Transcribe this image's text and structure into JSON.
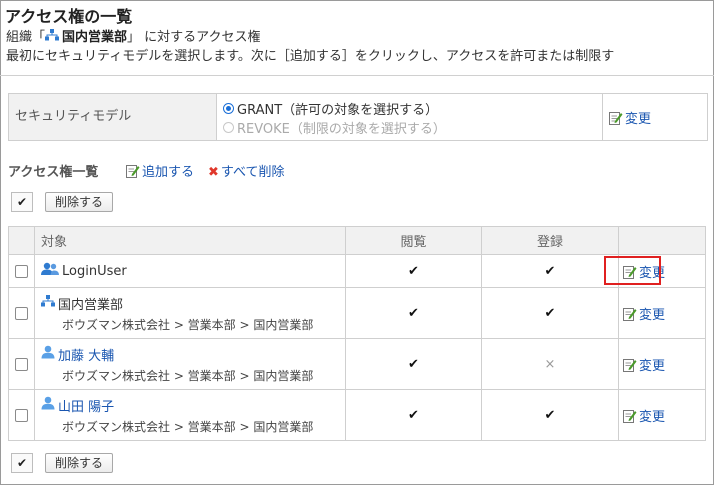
{
  "page": {
    "title": "アクセス権の一覧",
    "intro_prefix": "組織「",
    "org_name": "国内営業部",
    "intro_suffix": "」 に対するアクセス権",
    "intro_line2": "最初にセキュリティモデルを選択します。次に［追加する］をクリックし、アクセスを許可または制限す"
  },
  "security_model": {
    "label": "セキュリティモデル",
    "options": [
      {
        "label": "GRANT（許可の対象を選択する）",
        "selected": true,
        "disabled": false
      },
      {
        "label": "REVOKE（制限の対象を選択する）",
        "selected": false,
        "disabled": true
      }
    ],
    "change_label": "変更"
  },
  "acl": {
    "heading": "アクセス権一覧",
    "add_label": "追加する",
    "delete_all_label": "すべて削除",
    "select_all_mark": "✔",
    "delete_button": "削除する",
    "columns": {
      "target": "対象",
      "view": "閲覧",
      "register": "登録"
    },
    "rows": [
      {
        "type": "group",
        "name": "LoginUser",
        "path": "",
        "view": "✔",
        "register": "✔",
        "action": "変更"
      },
      {
        "type": "org",
        "name": "国内営業部",
        "path": "ボウズマン株式会社 > 営業本部 > 国内営業部",
        "view": "✔",
        "register": "✔",
        "action": "変更"
      },
      {
        "type": "user",
        "name": "加藤 大輔",
        "path": "ボウズマン株式会社 > 営業本部 > 国内営業部",
        "view": "✔",
        "register": "×",
        "action": "変更"
      },
      {
        "type": "user",
        "name": "山田 陽子",
        "path": "ボウズマン株式会社 > 営業本部 > 国内営業部",
        "view": "✔",
        "register": "✔",
        "action": "変更"
      }
    ]
  },
  "colors": {
    "link": "#1a56b0",
    "highlight": "#e02020",
    "header_bg": "#f1f1f1"
  }
}
